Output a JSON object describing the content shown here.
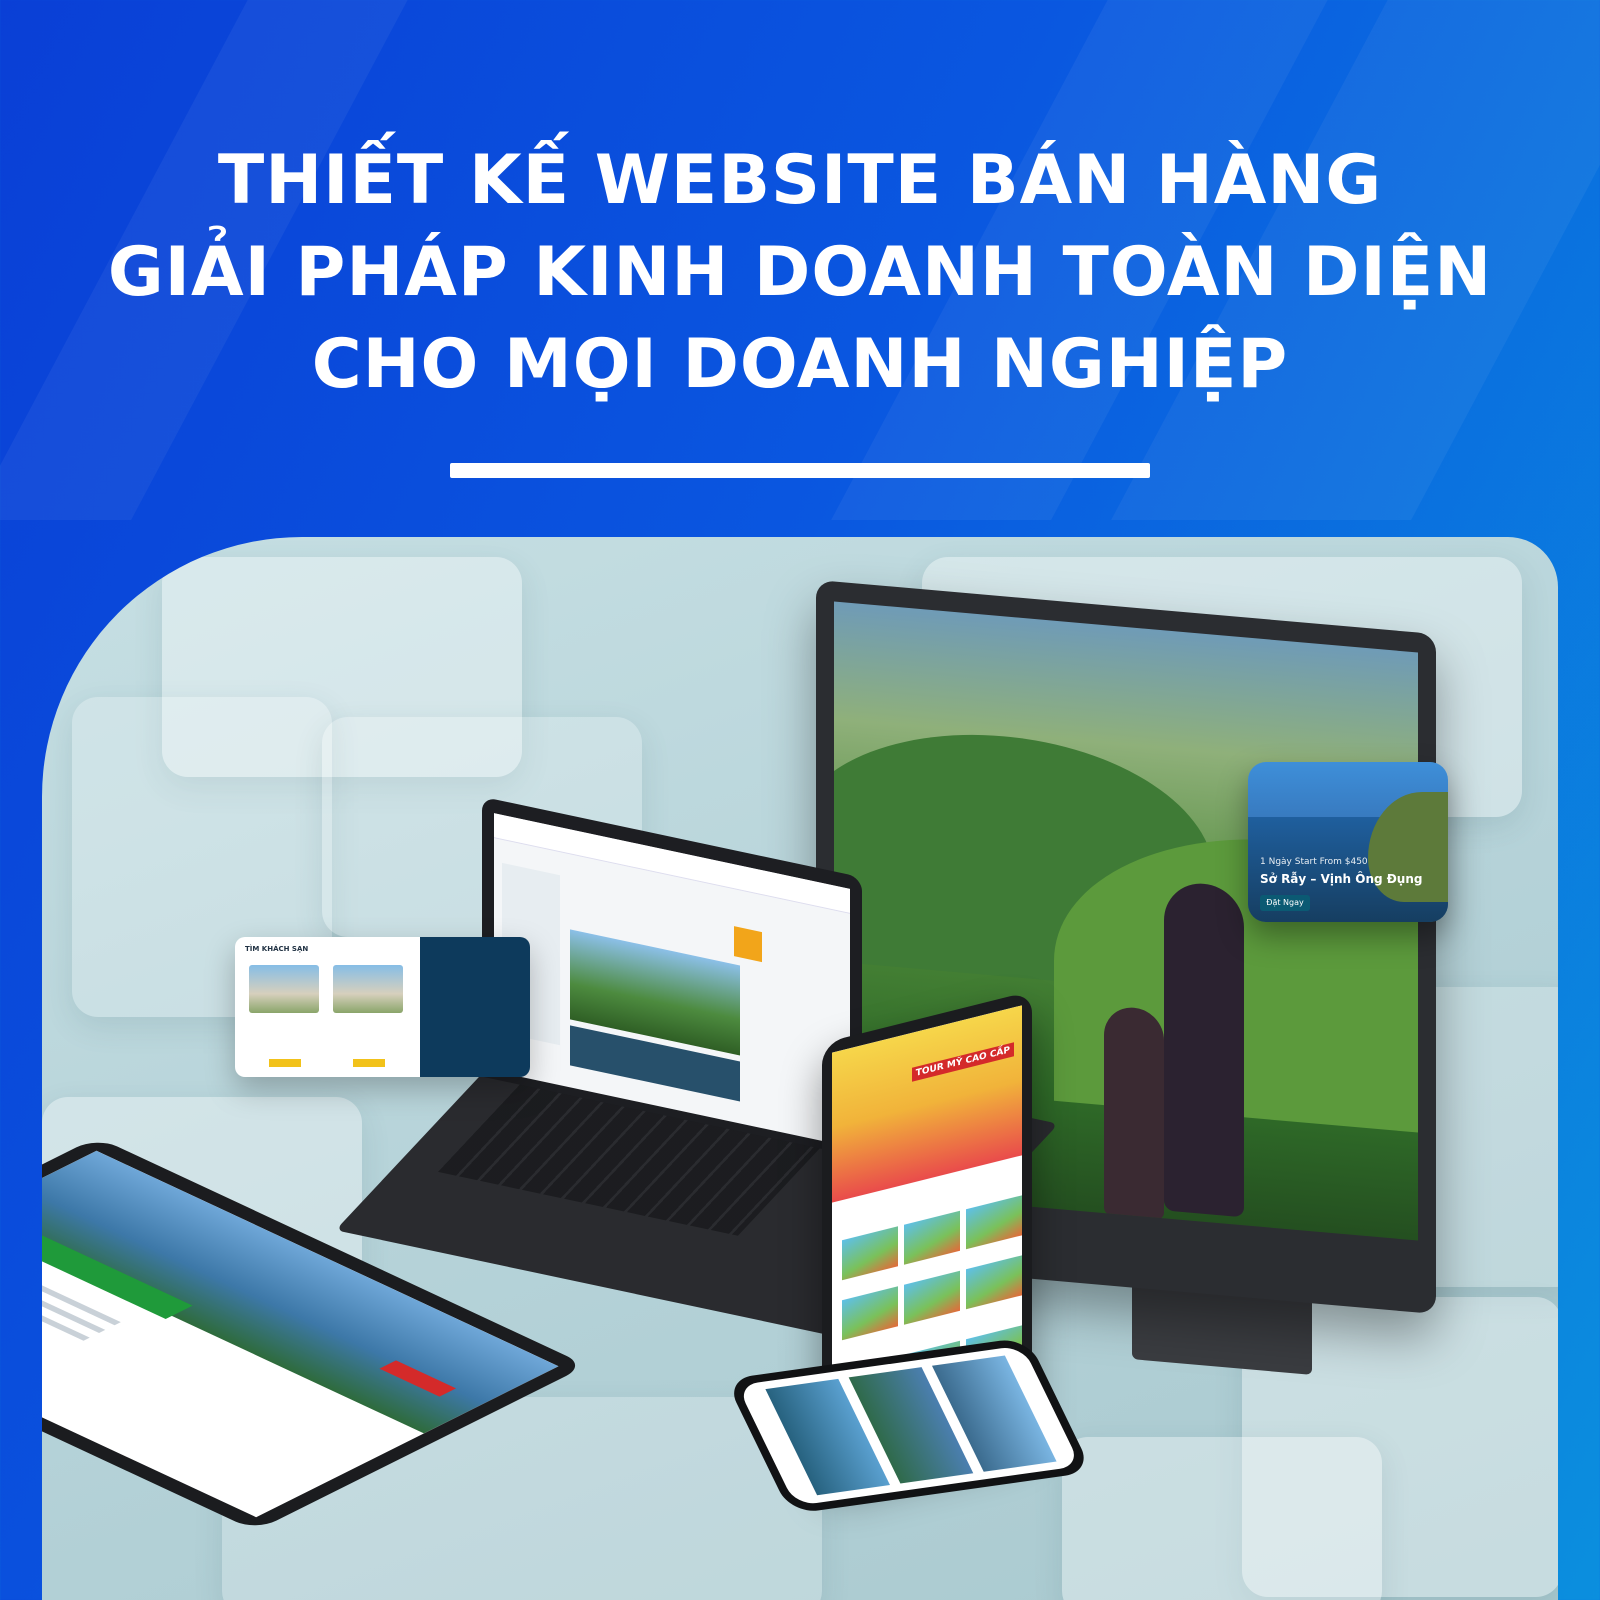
{
  "headline": {
    "line1": "THIẾT KẾ WEBSITE BÁN HÀNG",
    "line2": "GIẢI PHÁP KINH DOANH TOÀN DIỆN",
    "line3": "CHO MỌI DOANH NGHIỆP"
  },
  "tour_card": {
    "subtitle": "1 Ngày Start From $450",
    "title": "Sở Rẫy – Vịnh Ông Đụng",
    "button": "Đặt Ngay"
  },
  "hotel_card": {
    "caption": "TÌM KHÁCH SẠN"
  },
  "tablet_portrait": {
    "tag": "TOUR MỸ CAO CẤP"
  },
  "colors": {
    "background_start": "#0a3fd6",
    "background_end": "#0b8fde",
    "stage": "#bcd8dd",
    "accent_red": "#d42a2a",
    "accent_green": "#1f9a3a"
  }
}
